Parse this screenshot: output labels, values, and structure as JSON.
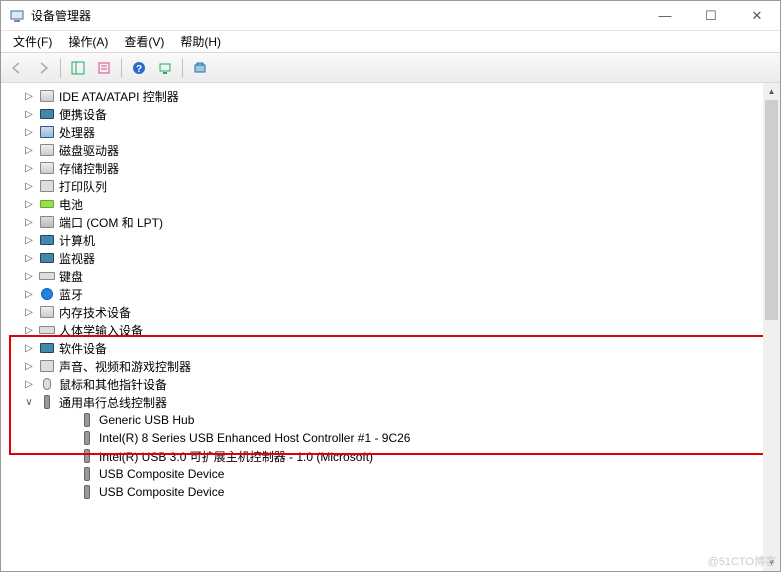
{
  "window": {
    "title": "设备管理器",
    "btn_min": "—",
    "btn_max": "☐",
    "btn_close": "✕"
  },
  "menu": {
    "file": "文件(F)",
    "action": "操作(A)",
    "view": "查看(V)",
    "help": "帮助(H)"
  },
  "toolbar": {
    "back": "back",
    "forward": "forward",
    "show_hide": "show-hide-console-tree",
    "properties": "properties",
    "help": "help",
    "scan": "scan-hardware",
    "devices": "devices-view"
  },
  "tree": {
    "items": [
      {
        "label": "IDE ATA/ATAPI 控制器",
        "icon": "disk",
        "disclosure": "▷"
      },
      {
        "label": "便携设备",
        "icon": "mon",
        "disclosure": "▷"
      },
      {
        "label": "处理器",
        "icon": "cpu",
        "disclosure": "▷"
      },
      {
        "label": "磁盘驱动器",
        "icon": "disk",
        "disclosure": "▷"
      },
      {
        "label": "存储控制器",
        "icon": "disk",
        "disclosure": "▷"
      },
      {
        "label": "打印队列",
        "icon": "prn",
        "disclosure": "▷"
      },
      {
        "label": "电池",
        "icon": "bat",
        "disclosure": "▷"
      },
      {
        "label": "端口 (COM 和 LPT)",
        "icon": "port",
        "disclosure": "▷"
      },
      {
        "label": "计算机",
        "icon": "mon",
        "disclosure": "▷"
      },
      {
        "label": "监视器",
        "icon": "mon",
        "disclosure": "▷"
      },
      {
        "label": "键盘",
        "icon": "kbd",
        "disclosure": "▷"
      },
      {
        "label": "蓝牙",
        "icon": "bt",
        "disclosure": "▷"
      },
      {
        "label": "内存技术设备",
        "icon": "disk",
        "disclosure": "▷"
      },
      {
        "label": "人体学输入设备",
        "icon": "kbd",
        "disclosure": "▷"
      },
      {
        "label": "软件设备",
        "icon": "mon",
        "disclosure": "▷"
      },
      {
        "label": "声音、视频和游戏控制器",
        "icon": "snd",
        "disclosure": "▷"
      },
      {
        "label": "鼠标和其他指针设备",
        "icon": "mouse",
        "disclosure": "▷"
      }
    ],
    "expanded": {
      "label": "通用串行总线控制器",
      "disclosure": "∨",
      "children": [
        {
          "label": "Generic USB Hub"
        },
        {
          "label": "Intel(R) 8 Series USB Enhanced Host Controller #1 - 9C26"
        },
        {
          "label": "Intel(R) USB 3.0 可扩展主机控制器 - 1.0 (Microsoft)"
        },
        {
          "label": "USB Composite Device"
        },
        {
          "label": "USB Composite Device"
        }
      ]
    }
  },
  "watermark": "@51CTO博客"
}
